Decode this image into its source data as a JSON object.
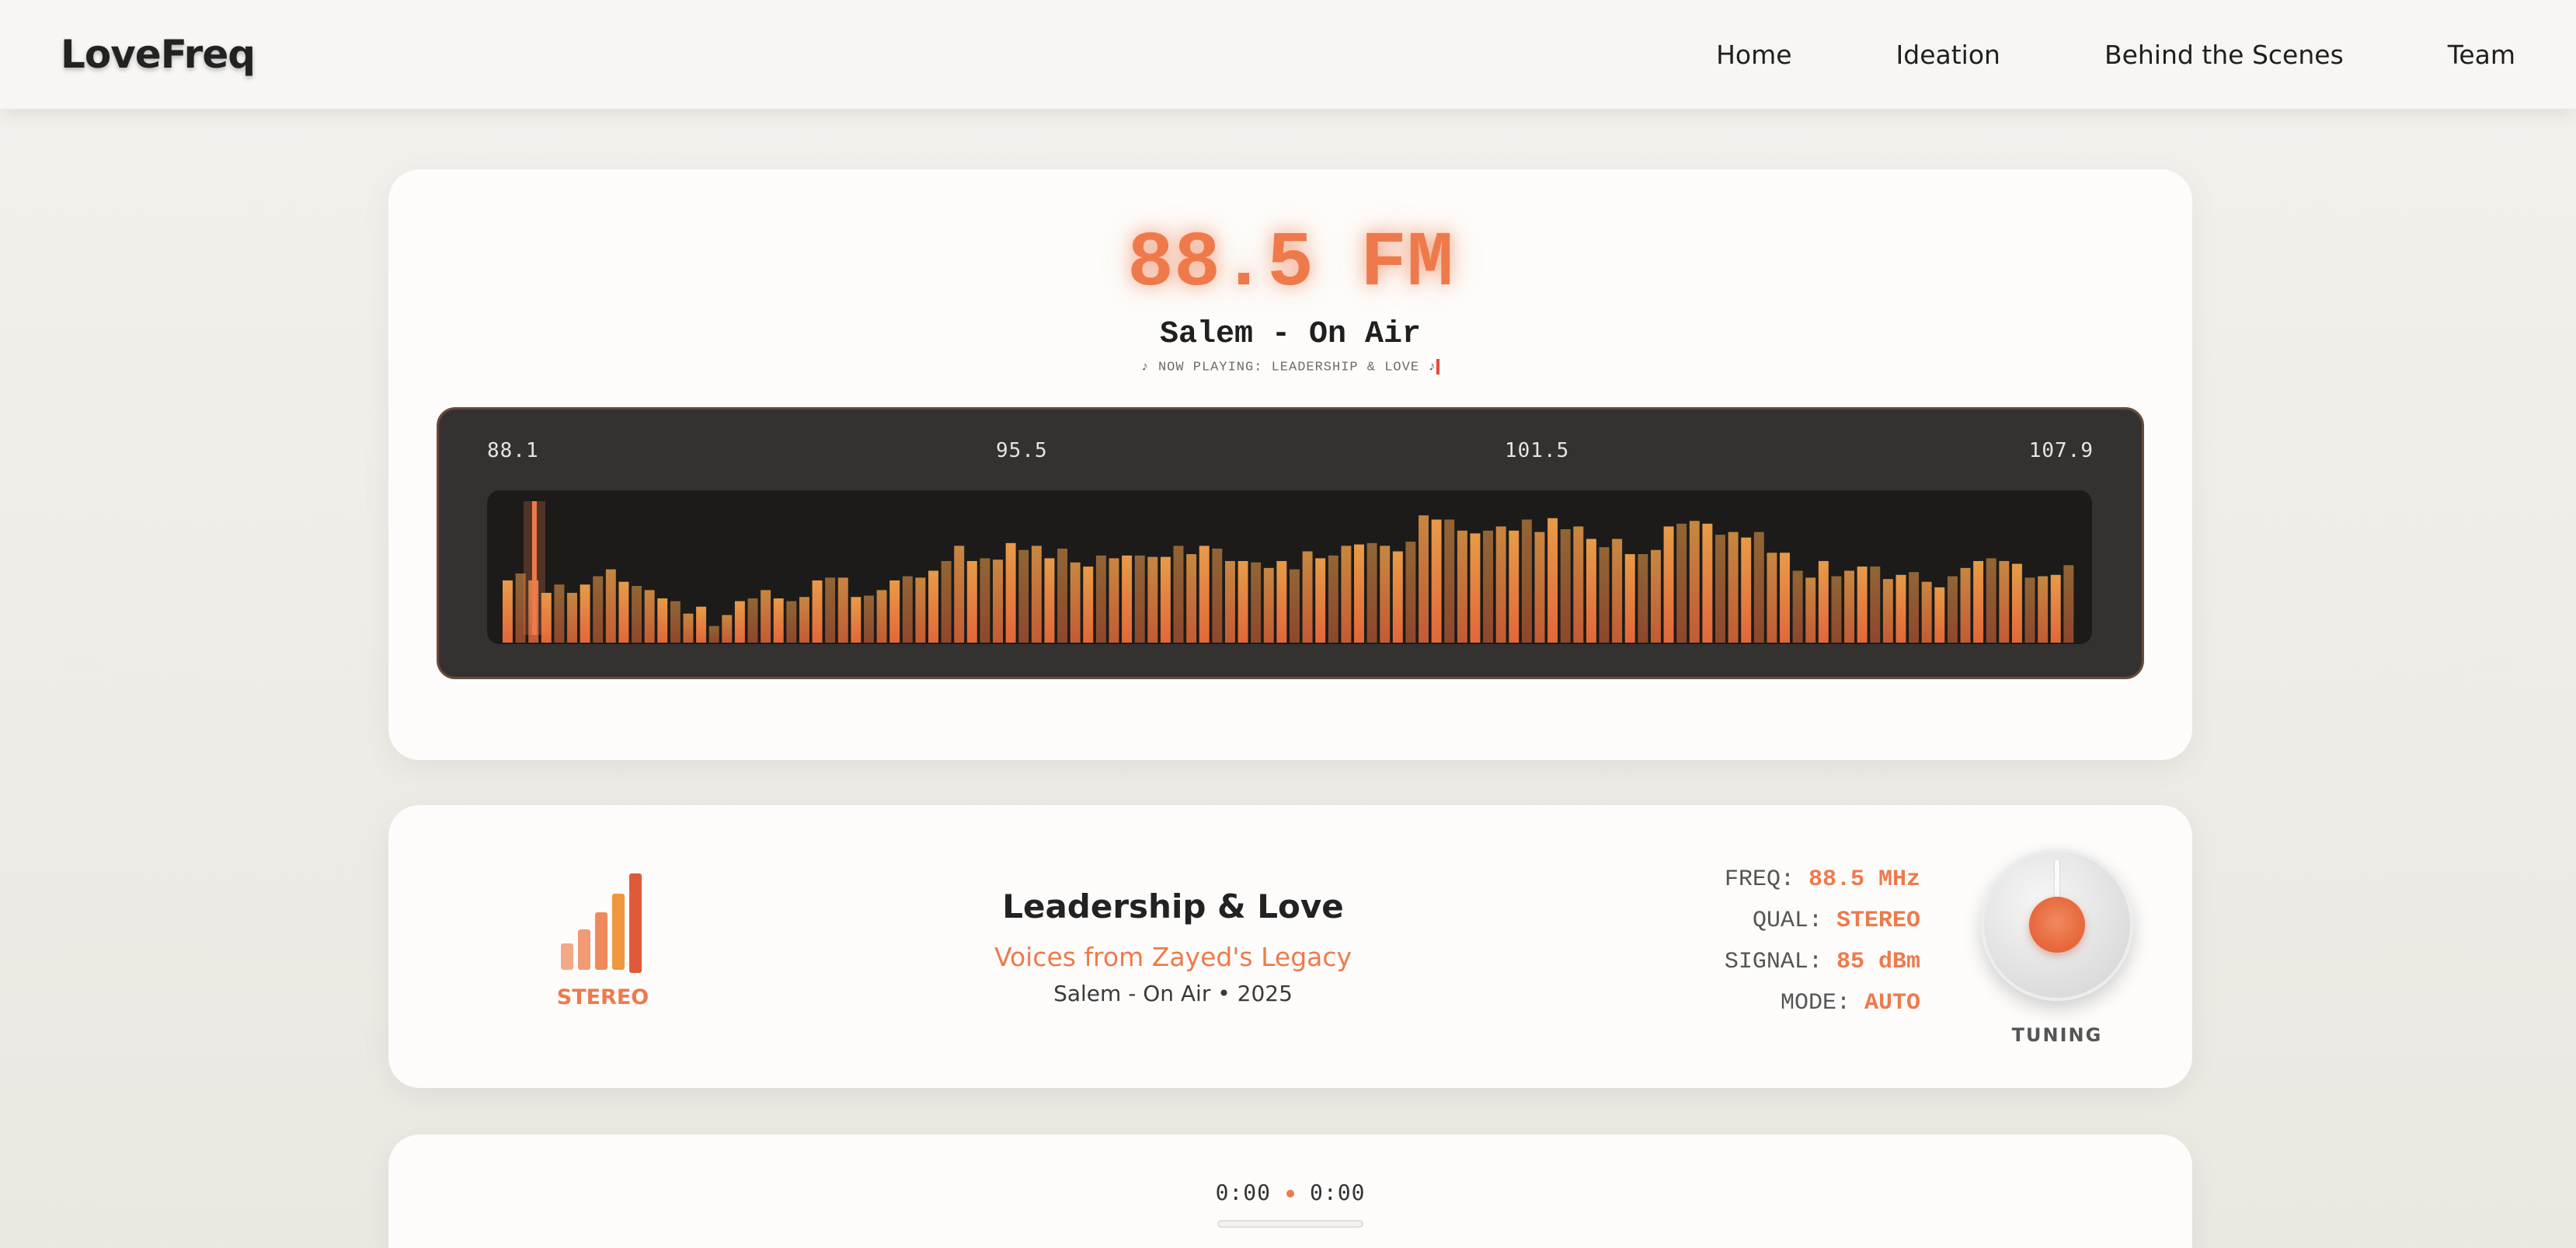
{
  "header": {
    "logo": "LoveFreq",
    "nav": [
      "Home",
      "Ideation",
      "Behind the Scenes",
      "Team"
    ]
  },
  "radio": {
    "frequency": "88.5 FM",
    "station": "Salem - On Air",
    "now_playing": "♪ NOW PLAYING: LEADERSHIP & LOVE ♪",
    "scale_labels": [
      "88.1",
      "95.5",
      "101.5",
      "107.9"
    ],
    "needle_value": 88.5,
    "colors": {
      "accent": "#ee7a4c",
      "bar_light": "#f2a24a",
      "bar_dark": "#7a5a30"
    }
  },
  "track": {
    "signal_label": "STEREO",
    "title": "Leadership & Love",
    "subtitle": "Voices from Zayed's Legacy",
    "meta": "Salem - On Air • 2025",
    "specs": [
      {
        "key": "FREQ:",
        "value": "88.5 MHz"
      },
      {
        "key": "QUAL:",
        "value": "STEREO"
      },
      {
        "key": "SIGNAL:",
        "value": "85 dBm"
      },
      {
        "key": "MODE:",
        "value": "AUTO"
      }
    ],
    "knob_label": "TUNING"
  },
  "player": {
    "current_time": "0:00",
    "duration": "0:00"
  },
  "chart_data": {
    "type": "bar",
    "title": "",
    "xlabel": "",
    "ylabel": "",
    "ylim": [
      0,
      1
    ],
    "values": [
      0.45,
      0.5,
      0.45,
      0.36,
      0.42,
      0.36,
      0.42,
      0.48,
      0.53,
      0.44,
      0.41,
      0.38,
      0.32,
      0.3,
      0.21,
      0.26,
      0.12,
      0.2,
      0.3,
      0.32,
      0.38,
      0.32,
      0.3,
      0.33,
      0.45,
      0.47,
      0.47,
      0.33,
      0.34,
      0.38,
      0.45,
      0.48,
      0.47,
      0.52,
      0.59,
      0.7,
      0.59,
      0.61,
      0.6,
      0.72,
      0.67,
      0.7,
      0.61,
      0.68,
      0.58,
      0.55,
      0.63,
      0.61,
      0.63,
      0.63,
      0.62,
      0.62,
      0.7,
      0.64,
      0.7,
      0.68,
      0.59,
      0.59,
      0.58,
      0.54,
      0.59,
      0.53,
      0.66,
      0.61,
      0.63,
      0.7,
      0.71,
      0.72,
      0.7,
      0.66,
      0.73,
      0.92,
      0.89,
      0.89,
      0.81,
      0.79,
      0.81,
      0.84,
      0.81,
      0.89,
      0.8,
      0.9,
      0.82,
      0.84,
      0.75,
      0.69,
      0.75,
      0.64,
      0.64,
      0.67,
      0.84,
      0.86,
      0.88,
      0.86,
      0.78,
      0.8,
      0.76,
      0.8,
      0.65,
      0.65,
      0.52,
      0.47,
      0.59,
      0.48,
      0.52,
      0.55,
      0.55,
      0.46,
      0.49,
      0.51,
      0.44,
      0.4,
      0.48,
      0.54,
      0.59,
      0.61,
      0.59,
      0.57,
      0.47,
      0.48,
      0.49,
      0.56
    ]
  }
}
